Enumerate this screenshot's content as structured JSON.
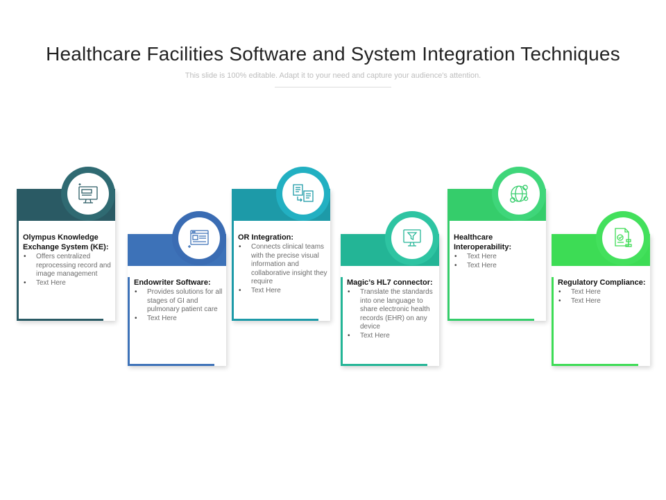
{
  "header": {
    "title": "Healthcare Facilities Software and System Integration Techniques",
    "subtitle": "This slide is 100% editable. Adapt it to your need and capture your audience's attention."
  },
  "cards": [
    {
      "title": "Olympus Knowledge Exchange System (KE):",
      "color": "#2a5a64",
      "ring_color": "#2f6a72",
      "icon": "monitor-icon",
      "bullets": [
        "Offers centralized reprocessing record and image management",
        "Text Here"
      ]
    },
    {
      "title": "Endowriter Software:",
      "color": "#3d72b8",
      "ring_color": "#3a6cb3",
      "icon": "browser-window-icon",
      "bullets": [
        "Provides solutions for all stages of GI and pulmonary patient care",
        "Text Here"
      ]
    },
    {
      "title": "OR Integration:",
      "color": "#1d9aa8",
      "ring_color": "#22b0c2",
      "icon": "document-transfer-icon",
      "bullets": [
        "Connects clinical teams with the precise visual information and collaborative insight they require",
        "Text Here"
      ]
    },
    {
      "title": "Magic’s HL7 connector:",
      "color": "#23b596",
      "ring_color": "#2ec4a2",
      "icon": "computer-filter-icon",
      "bullets": [
        "Translate the standards into one language to share electronic health records (EHR) on any device",
        "Text Here"
      ]
    },
    {
      "title": "Healthcare Interoperability:",
      "color": "#35cd6b",
      "ring_color": "#3fd67a",
      "icon": "global-network-icon",
      "bullets": [
        "Text Here",
        "Text Here"
      ]
    },
    {
      "title": "Regulatory Compliance:",
      "color": "#3ddc55",
      "ring_color": "#43e05c",
      "icon": "certificate-stamp-icon",
      "bullets": [
        "Text Here",
        "Text Here"
      ]
    }
  ]
}
